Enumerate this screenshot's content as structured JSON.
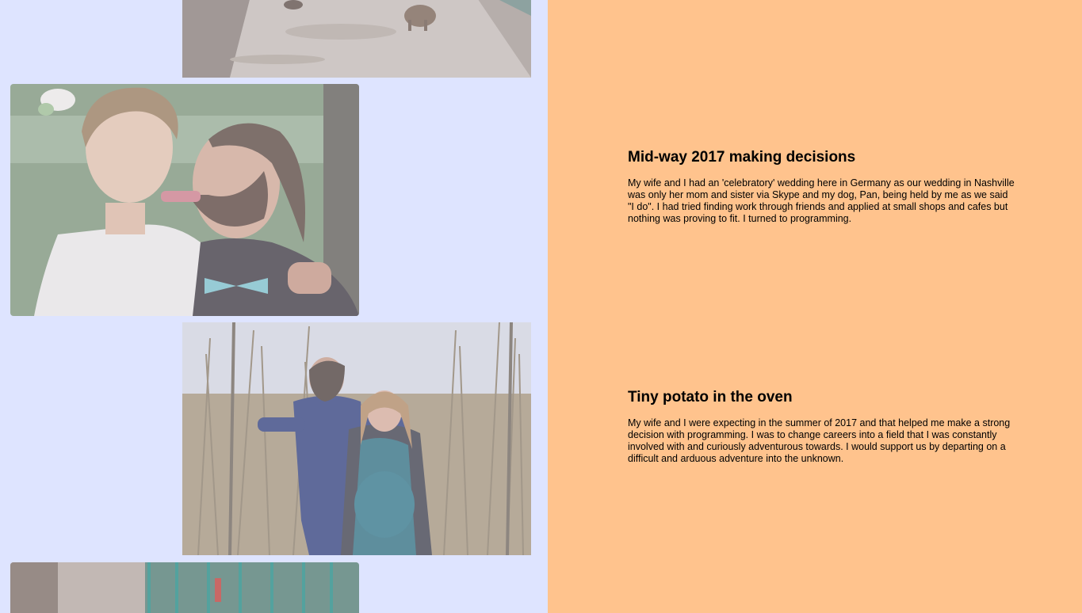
{
  "colors": {
    "left_background": "#dee4ff",
    "right_background": "#ffc38d",
    "text": "#000000"
  },
  "photos": [
    {
      "name": "park-path-photo",
      "depicts": "dog on a dirt path in a park"
    },
    {
      "name": "wedding-couple-photo",
      "depicts": "bride and groom making funny faces"
    },
    {
      "name": "reeds-couple-photo",
      "depicts": "couple in tall reeds, expecting"
    },
    {
      "name": "fence-path-photo",
      "depicts": "path with green fence"
    }
  ],
  "entries": [
    {
      "title": "Mid-way 2017 making decisions",
      "body": "My wife and I had an 'celebratory' wedding here in Germany as our wedding in Nashville was only her mom and sister via Skype and my dog, Pan, being held by me as we said \"I do\". I had tried finding work through friends and applied at small shops and cafes but nothing was proving to fit. I turned to programming."
    },
    {
      "title": "Tiny potato in the oven",
      "body": "My wife and I were expecting in the summer of 2017 and that helped me make a strong decision with programming. I was to change careers into a field that I was constantly involved with and curiously adventurous towards. I would support us by departing on a difficult and arduous adventure into the unknown."
    }
  ]
}
